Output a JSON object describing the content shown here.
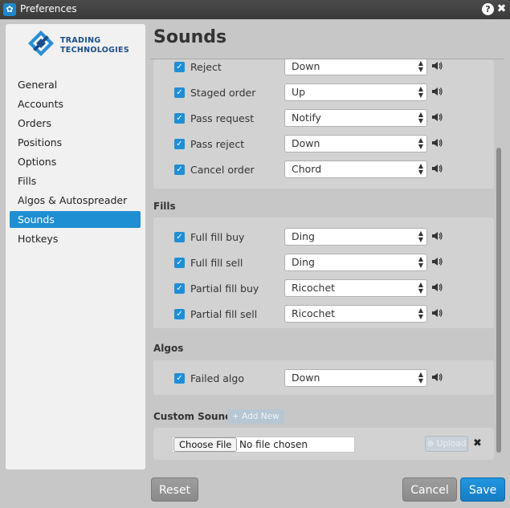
{
  "window": {
    "title": "Preferences",
    "help_glyph": "?",
    "close_glyph": "✖"
  },
  "sidebar": {
    "logo_line1": "TRADING",
    "logo_line2": "TECHNOLOGIES",
    "items": [
      {
        "label": "General"
      },
      {
        "label": "Accounts"
      },
      {
        "label": "Orders"
      },
      {
        "label": "Positions"
      },
      {
        "label": "Options"
      },
      {
        "label": "Fills"
      },
      {
        "label": "Algos & Autospreader"
      },
      {
        "label": "Sounds",
        "active": true
      },
      {
        "label": "Hotkeys"
      }
    ]
  },
  "main": {
    "title": "Sounds",
    "orders_rows": [
      {
        "label": "Reject",
        "sound": "Down",
        "checked": true
      },
      {
        "label": "Staged order",
        "sound": "Up",
        "checked": true
      },
      {
        "label": "Pass request",
        "sound": "Notify",
        "checked": true
      },
      {
        "label": "Pass reject",
        "sound": "Down",
        "checked": true
      },
      {
        "label": "Cancel order",
        "sound": "Chord",
        "checked": true
      }
    ],
    "fills_section": "Fills",
    "fills_rows": [
      {
        "label": "Full fill buy",
        "sound": "Ding",
        "checked": true
      },
      {
        "label": "Full fill sell",
        "sound": "Ding",
        "checked": true
      },
      {
        "label": "Partial fill buy",
        "sound": "Ricochet",
        "checked": true
      },
      {
        "label": "Partial fill sell",
        "sound": "Ricochet",
        "checked": true
      }
    ],
    "algos_section": "Algos",
    "algos_rows": [
      {
        "label": "Failed algo",
        "sound": "Down",
        "checked": true
      }
    ],
    "custom_section": "Custom Sounds",
    "add_new_label": "+ Add New",
    "choose_file_label": "Choose File",
    "no_file_text": "No file chosen",
    "upload_label": "⊕ Upload",
    "remove_glyph": "✖"
  },
  "footer": {
    "reset_label": "Reset",
    "cancel_label": "Cancel",
    "save_label": "Save"
  },
  "colors": {
    "accent": "#1f8fd3",
    "titlebar": "#3a3a3a",
    "panel": "#d2d2d2"
  }
}
